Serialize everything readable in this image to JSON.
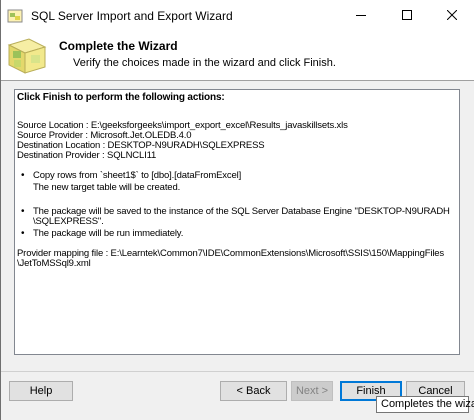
{
  "window": {
    "title": "SQL Server Import and Export Wizard"
  },
  "header": {
    "title": "Complete the Wizard",
    "subtitle": "Verify the choices made in the wizard and click Finish."
  },
  "summary": {
    "heading": "Click Finish to perform the following actions:",
    "source_location": "Source Location : E:\\geeksforgeeks\\import_export_excel\\Results_javaskillsets.xls",
    "source_provider": "Source Provider : Microsoft.Jet.OLEDB.4.0",
    "destination_location": "Destination Location : DESKTOP-N9URADH\\SQLEXPRESS",
    "destination_provider": "Destination Provider : SQLNCLI11",
    "bullets": [
      {
        "symbol": "•",
        "lines": [
          "Copy rows from `sheet1$` to [dbo].[dataFromExcel]",
          "The new target table will be created."
        ]
      },
      {
        "symbol": "•",
        "lines": [
          "The package will be saved to the instance of the SQL Server Database Engine \"DESKTOP-N9URADH",
          "\\SQLEXPRESS\"."
        ]
      },
      {
        "symbol": "•",
        "lines": [
          "The package will be run immediately."
        ]
      }
    ],
    "mapping_file": [
      "Provider mapping file : E:\\Learntek\\Common7\\IDE\\CommonExtensions\\Microsoft\\SSIS\\150\\MappingFiles",
      "\\JetToMSSql9.xml"
    ]
  },
  "buttons": {
    "help": "Help",
    "back": "< Back",
    "next": "Next >",
    "finish": "Finish",
    "cancel": "Cancel"
  },
  "tooltip": "Completes the wizard",
  "colors": {
    "accent": "#0078d7",
    "header_bg": "#ffffff",
    "dialog_bg": "#f0f0f0"
  },
  "icons": {
    "app": "sql-server-wizard-icon",
    "header": "wizard-icon",
    "minimize": "minimize-icon",
    "maximize": "maximize-icon",
    "close": "close-icon"
  }
}
